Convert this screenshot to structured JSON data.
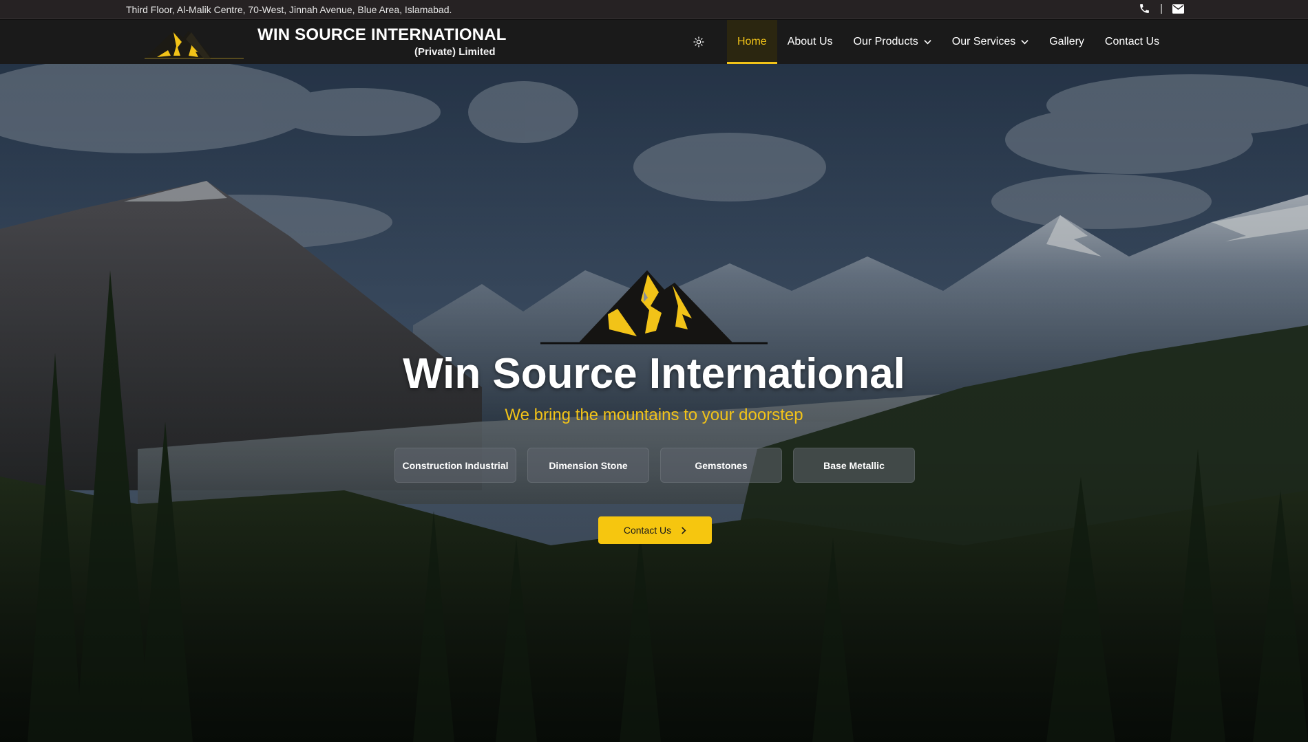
{
  "topbar": {
    "address": "Third Floor, Al-Malik Centre, 70-West, Jinnah Avenue, Blue Area, Islamabad.",
    "separator": "|",
    "icons": [
      "phone-icon",
      "envelope-icon"
    ]
  },
  "brand": {
    "title": "WIN SOURCE INTERNATIONAL",
    "subtitle": "(Private) Limited"
  },
  "nav": {
    "theme_icon": "sun-icon",
    "items": [
      {
        "label": "Home",
        "active": true
      },
      {
        "label": "About Us"
      },
      {
        "label": "Our Products",
        "dropdown": true
      },
      {
        "label": "Our Services",
        "dropdown": true
      },
      {
        "label": "Gallery"
      },
      {
        "label": "Contact Us"
      }
    ]
  },
  "hero": {
    "title": "Win Source International",
    "tagline": "We bring the mountains to your doorstep",
    "categories": [
      "Construction Industrial",
      "Dimension Stone",
      "Gemstones",
      "Base Metallic"
    ],
    "cta_label": "Contact Us",
    "cta_icon": "chevron-right-icon"
  },
  "colors": {
    "accent": "#f2c318",
    "topbar_bg": "#262223",
    "navbar_bg": "#1a1a1a",
    "cta_bg": "#f6c60f"
  }
}
